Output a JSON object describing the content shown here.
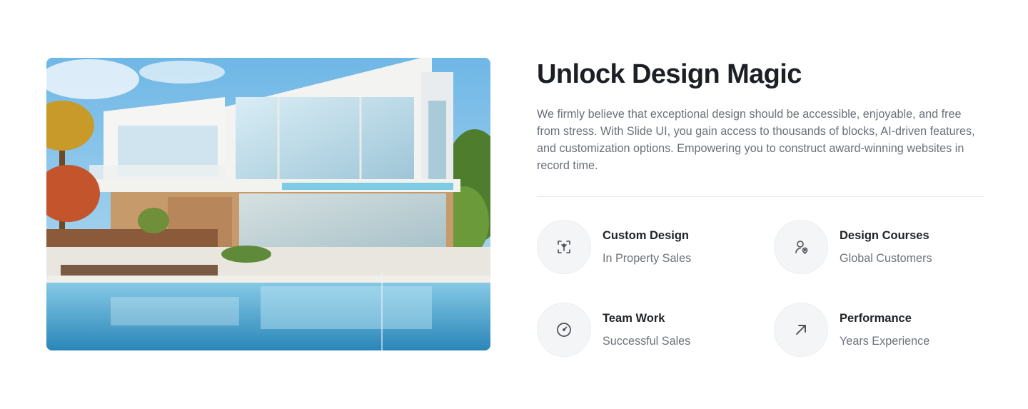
{
  "hero": {
    "image_alt": "modern-villa-with-pool-photo"
  },
  "section": {
    "title": "Unlock Design Magic",
    "description": "We firmly believe that exceptional design should be accessible, enjoyable, and free from stress. With Slide UI, you gain access to thousands of blocks, AI-driven features, and customization options. Empowering you to construct award-winning websites in record time."
  },
  "features": [
    {
      "icon": "design-focus-icon",
      "title": "Custom Design",
      "subtitle": "In Property Sales"
    },
    {
      "icon": "user-location-icon",
      "title": "Design Courses",
      "subtitle": "Global Customers"
    },
    {
      "icon": "gauge-icon",
      "title": "Team Work",
      "subtitle": "Successful Sales"
    },
    {
      "icon": "arrow-up-right-icon",
      "title": "Performance",
      "subtitle": "Years Experience"
    }
  ],
  "colors": {
    "title": "#1c1f24",
    "body_text": "#6b7078",
    "icon_circle_bg": "#f4f5f6",
    "icon_stroke": "#4a4f57",
    "divider": "#e7e8ea"
  }
}
